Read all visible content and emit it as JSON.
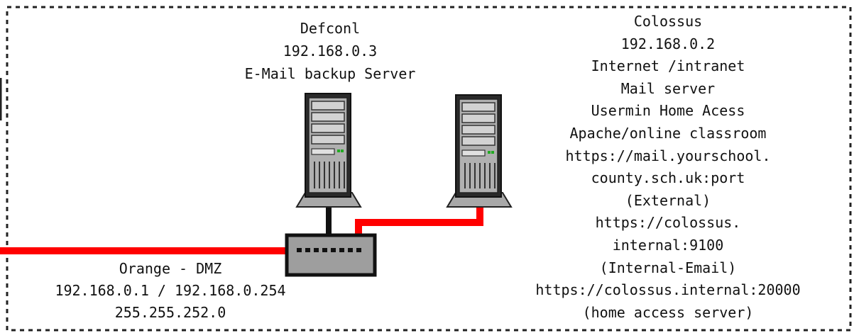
{
  "servers": {
    "defcon": {
      "lines": [
        "Defconl",
        "192.168.0.3",
        "E-Mail backup Server"
      ]
    },
    "colossus": {
      "lines": [
        "Colossus",
        "192.168.0.2",
        "Internet /intranet",
        "Mail server",
        "Usermin Home Acess",
        "Apache/online classroom",
        "https://mail.yourschool.",
        "county.sch.uk:port",
        "(External)",
        "https://colossus.",
        "internal:9100",
        "(Internal-Email)",
        "https://colossus.internal:20000",
        "(home access server)"
      ]
    }
  },
  "zone": {
    "lines": [
      "Orange - DMZ",
      "192.168.0.1 / 192.168.0.254",
      "255.255.252.0"
    ]
  },
  "colors": {
    "link_red": "#ff0000",
    "cable_black": "#111111",
    "server_gray": "#a8a8a8",
    "switch_gray": "#9e9e9e"
  }
}
